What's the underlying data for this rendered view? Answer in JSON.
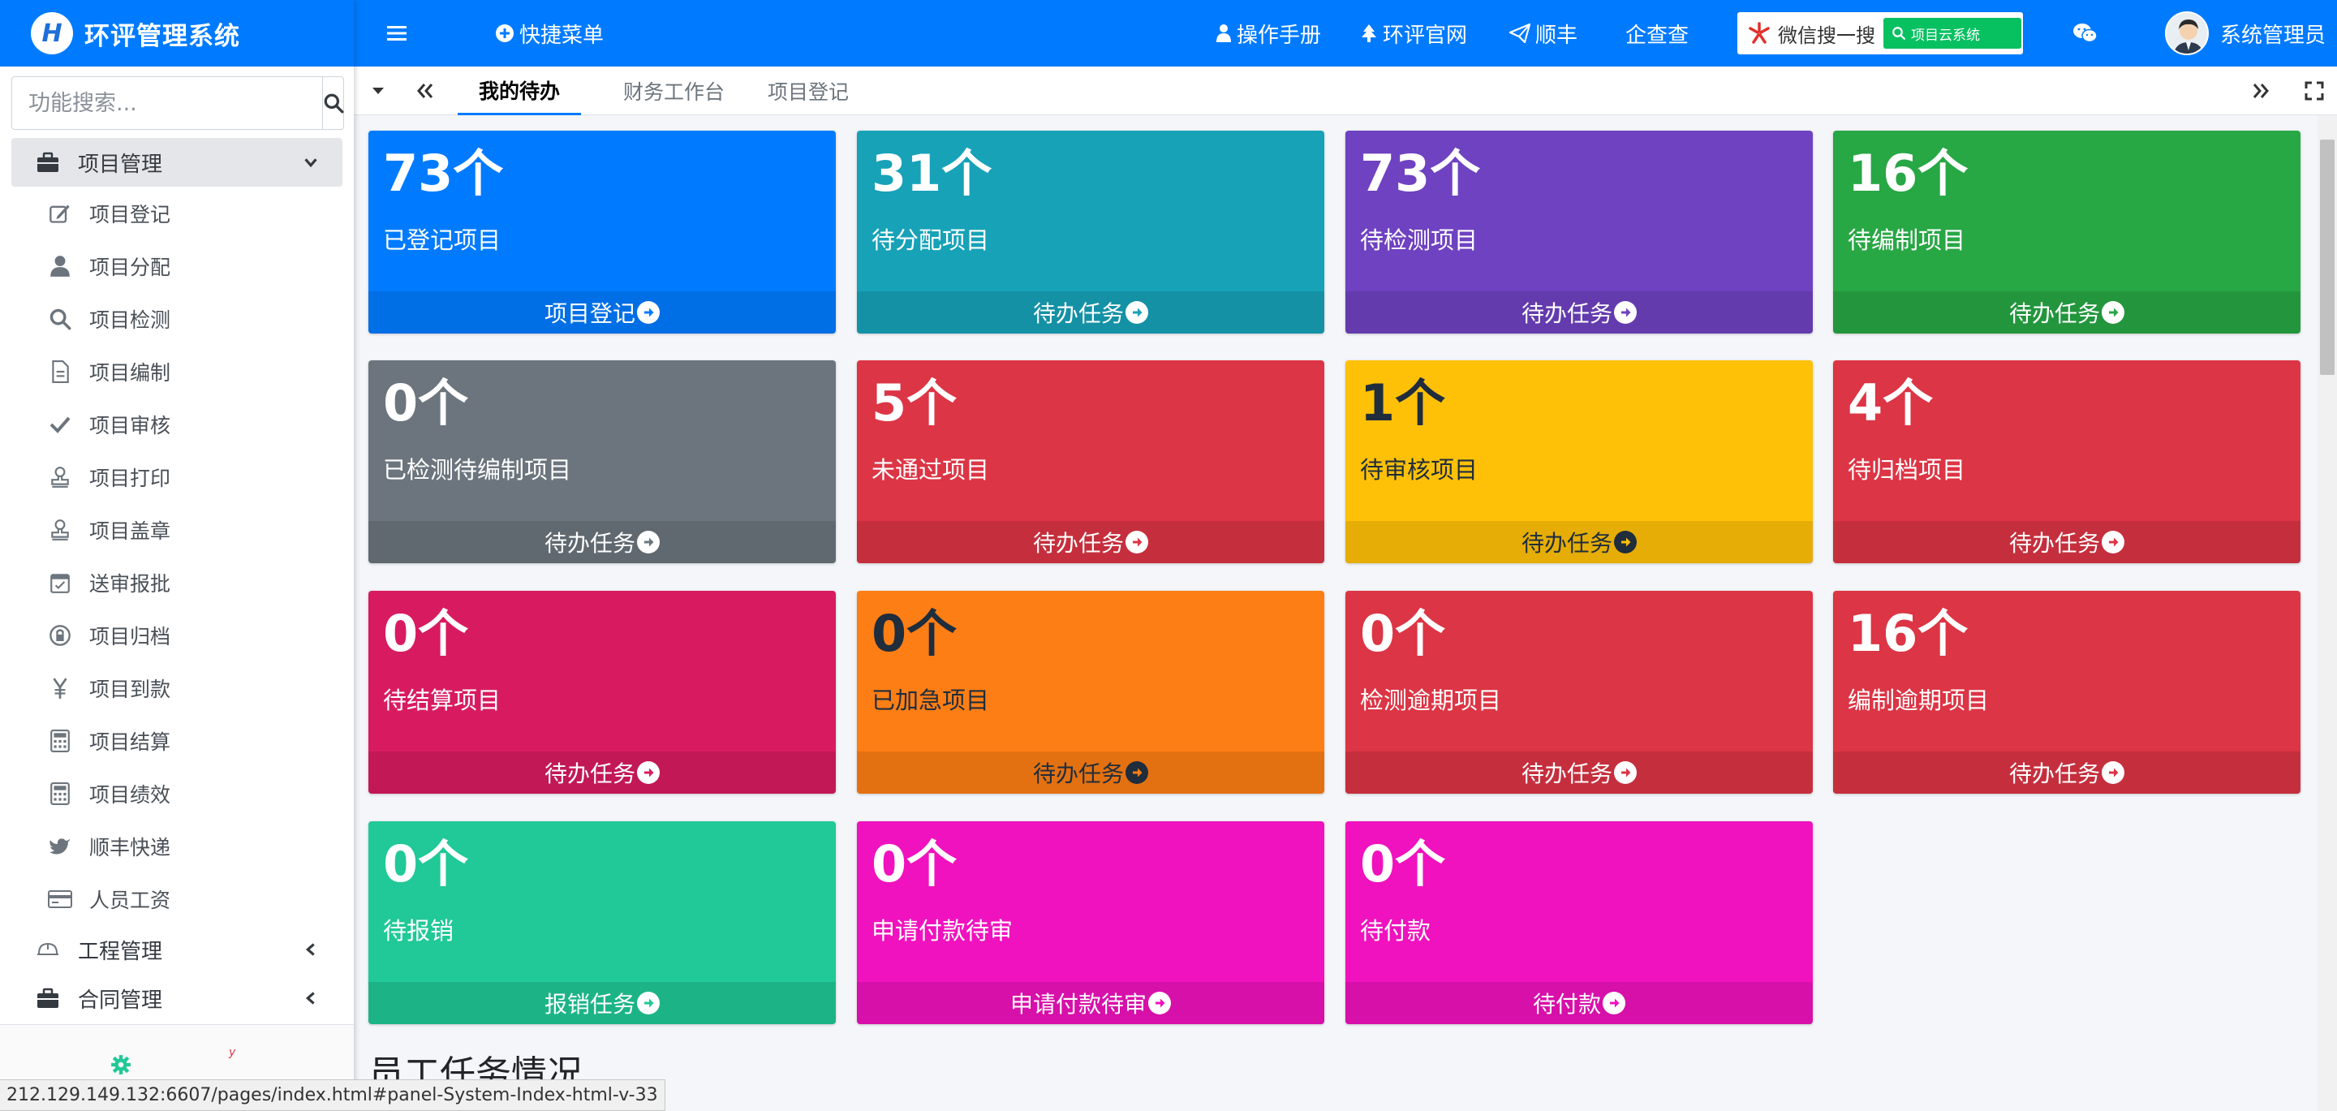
{
  "brand": {
    "logo_text": "H",
    "name": "环评管理系统"
  },
  "sidebar": {
    "search_placeholder": "功能搜索...",
    "groups": [
      {
        "label": "项目管理",
        "expanded": true,
        "icon": "briefcase-icon",
        "items": [
          {
            "label": "项目登记",
            "icon": "edit-icon"
          },
          {
            "label": "项目分配",
            "icon": "user-icon"
          },
          {
            "label": "项目检测",
            "icon": "search-icon"
          },
          {
            "label": "项目编制",
            "icon": "file-icon"
          },
          {
            "label": "项目审核",
            "icon": "check-icon"
          },
          {
            "label": "项目打印",
            "icon": "stamp-icon"
          },
          {
            "label": "项目盖章",
            "icon": "stamp-icon"
          },
          {
            "label": "送审报批",
            "icon": "calendar-check-icon"
          },
          {
            "label": "项目归档",
            "icon": "archive-lock-icon"
          },
          {
            "label": "项目到款",
            "icon": "yen-icon"
          },
          {
            "label": "项目结算",
            "icon": "calculator-icon"
          },
          {
            "label": "项目绩效",
            "icon": "calculator-icon"
          },
          {
            "label": "顺丰快递",
            "icon": "twitter-icon"
          },
          {
            "label": "人员工资",
            "icon": "credit-card-icon"
          }
        ]
      },
      {
        "label": "工程管理",
        "expanded": false,
        "icon": "hard-hat-icon"
      },
      {
        "label": "合同管理",
        "expanded": false,
        "icon": "briefcase-icon"
      }
    ]
  },
  "topbar": {
    "quick_menu": "快捷菜单",
    "manual": "操作手册",
    "official_site": "环评官网",
    "sf": "顺丰",
    "qcc": "企查查",
    "wechat_search": "微信搜一搜",
    "wechat_search_tag": "项目云系统",
    "user": "系统管理员"
  },
  "tabs": [
    {
      "label": "我的待办",
      "active": true
    },
    {
      "label": "财务工作台",
      "active": false
    },
    {
      "label": "项目登记",
      "active": false
    }
  ],
  "boxes": [
    {
      "count": "73个",
      "label": "已登记项目",
      "footer": "项目登记",
      "color": "#007bff"
    },
    {
      "count": "31个",
      "label": "待分配项目",
      "footer": "待办任务",
      "color": "#17a2b8"
    },
    {
      "count": "73个",
      "label": "待检测项目",
      "footer": "待办任务",
      "color": "#6f42c1"
    },
    {
      "count": "16个",
      "label": "待编制项目",
      "footer": "待办任务",
      "color": "#28a745"
    },
    {
      "count": "0个",
      "label": "已检测待编制项目",
      "footer": "待办任务",
      "color": "#6c757d"
    },
    {
      "count": "5个",
      "label": "未通过项目",
      "footer": "待办任务",
      "color": "#dc3545"
    },
    {
      "count": "1个",
      "label": "待审核项目",
      "footer": "待办任务",
      "color": "#ffc107"
    },
    {
      "count": "4个",
      "label": "待归档项目",
      "footer": "待办任务",
      "color": "#dc3545"
    },
    {
      "count": "0个",
      "label": "待结算项目",
      "footer": "待办任务",
      "color": "#d81b60"
    },
    {
      "count": "0个",
      "label": "已加急项目",
      "footer": "待办任务",
      "color": "#fd7e14"
    },
    {
      "count": "0个",
      "label": "检测逾期项目",
      "footer": "待办任务",
      "color": "#dc3545"
    },
    {
      "count": "16个",
      "label": "编制逾期项目",
      "footer": "待办任务",
      "color": "#dc3545"
    },
    {
      "count": "0个",
      "label": "待报销",
      "footer": "报销任务",
      "color": "#20c997"
    },
    {
      "count": "0个",
      "label": "申请付款待审",
      "footer": "申请付款待审",
      "color": "#f012be"
    },
    {
      "count": "0个",
      "label": "待付款",
      "footer": "待付款",
      "color": "#f012be"
    }
  ],
  "section_title": "员工任务情况",
  "status_url": "212.129.149.132:6607/pages/index.html#panel-System-Index-html-v-33"
}
